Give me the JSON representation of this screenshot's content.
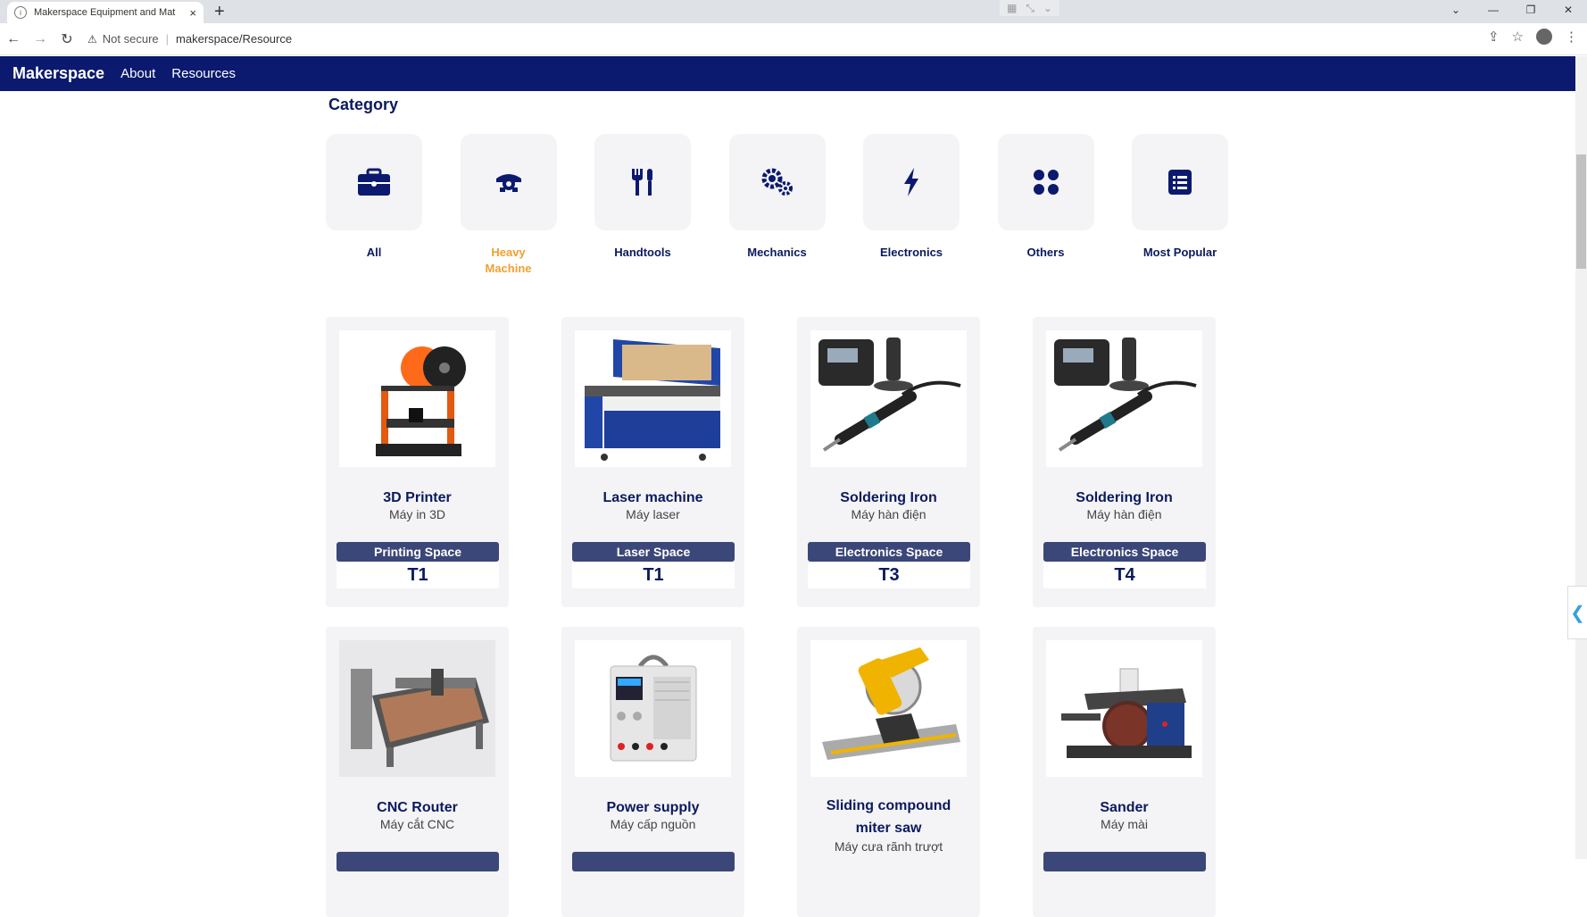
{
  "browser": {
    "tab_title": "Makerspace Equipment and Mat",
    "tab_close": "×",
    "new_tab": "+",
    "security": "Not secure",
    "url": "makerspace/Resource"
  },
  "nav": {
    "brand": "Makerspace",
    "links": [
      "About",
      "Resources"
    ]
  },
  "category": {
    "title": "Category",
    "items": [
      {
        "label": "All",
        "icon": "toolbox-icon",
        "active": false
      },
      {
        "label": "Heavy Machine",
        "icon": "heavy-machine-icon",
        "active": true
      },
      {
        "label": "Handtools",
        "icon": "tools-icon",
        "active": false
      },
      {
        "label": "Mechanics",
        "icon": "gears-icon",
        "active": false
      },
      {
        "label": "Electronics",
        "icon": "bolt-icon",
        "active": false
      },
      {
        "label": "Others",
        "icon": "dots-icon",
        "active": false
      },
      {
        "label": "Most Popular",
        "icon": "list-icon",
        "active": false
      }
    ]
  },
  "products": [
    {
      "name": "3D Printer",
      "sub": "Máy in 3D",
      "space": "Printing Space",
      "location": "T1",
      "image": "3d-printer-image"
    },
    {
      "name": "Laser machine",
      "sub": "Máy laser",
      "space": "Laser Space",
      "location": "T1",
      "image": "laser-machine-image"
    },
    {
      "name": "Soldering Iron",
      "sub": "Máy hàn điện",
      "space": "Electronics Space",
      "location": "T3",
      "image": "soldering-iron-image"
    },
    {
      "name": "Soldering Iron",
      "sub": "Máy hàn điện",
      "space": "Electronics Space",
      "location": "T4",
      "image": "soldering-iron-image"
    },
    {
      "name": "CNC Router",
      "sub": "Máy cắt CNC",
      "image": "cnc-router-image"
    },
    {
      "name": "Power supply",
      "sub": "Máy cấp nguồn",
      "image": "power-supply-image"
    },
    {
      "name": "Sliding compound miter saw",
      "sub": "Máy cưa rãnh trượt",
      "image": "miter-saw-image"
    },
    {
      "name": "Sander",
      "sub": "Máy mài",
      "image": "sander-image"
    }
  ],
  "colors": {
    "nav_bg": "#0b1a6e",
    "accent": "#f0a030",
    "space_badge": "#3b4778",
    "card_bg": "#f4f4f6"
  }
}
